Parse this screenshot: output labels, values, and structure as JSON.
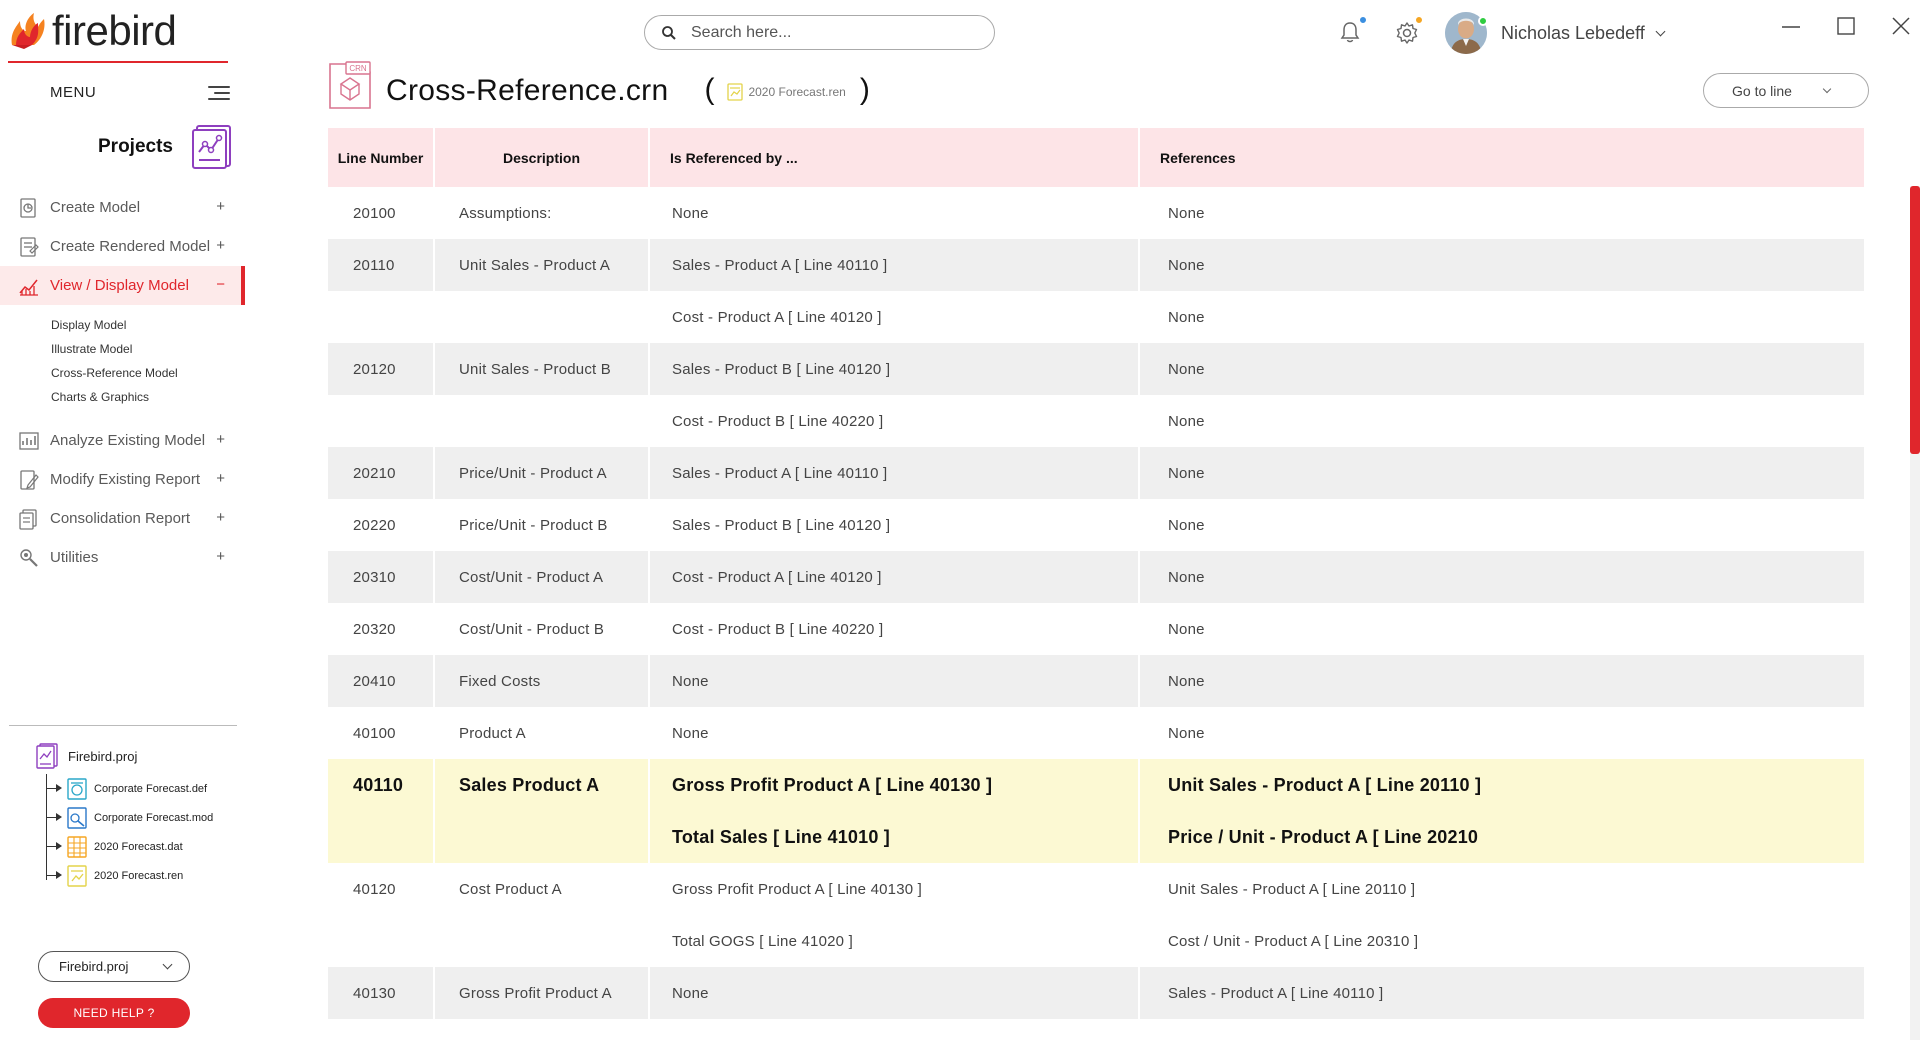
{
  "app": {
    "name": "firebird",
    "accent": "#e0262c"
  },
  "sidebar": {
    "menu_label": "MENU",
    "projects_title": "Projects",
    "nav": [
      {
        "label": "Create Model",
        "sign": "+"
      },
      {
        "label": "Create Rendered Model",
        "sign": "+"
      },
      {
        "label": "View / Display Model",
        "sign": "−",
        "active": true
      },
      {
        "label": "Analyze Existing Model",
        "sign": "+"
      },
      {
        "label": "Modify Existing Report",
        "sign": "+"
      },
      {
        "label": "Consolidation Report",
        "sign": "+"
      },
      {
        "label": "Utilities",
        "sign": "+"
      }
    ],
    "subnav": [
      "Display Model",
      "Illustrate Model",
      "Cross-Reference Model",
      "Charts & Graphics"
    ],
    "tree": {
      "root": "Firebird.proj",
      "children": [
        "Corporate Forecast.def",
        "Corporate Forecast.mod",
        "2020 Forecast.dat",
        "2020 Forecast.ren"
      ]
    },
    "project_select": "Firebird.proj",
    "help_label": "NEED HELP ?"
  },
  "topbar": {
    "search_placeholder": "Search here...",
    "user_name": "Nicholas Lebedeff",
    "notification_dot": "#3b8fe0",
    "settings_dot": "#f5a623"
  },
  "page": {
    "title": "Cross-Reference.crn",
    "paren_open": "(",
    "paren_close": ")",
    "source_file": "2020 Forecast.ren",
    "goto_label": "Go to line"
  },
  "table": {
    "headers": {
      "line": "Line Number",
      "description": "Description",
      "referenced_by": "Is Referenced by ...",
      "references": "References"
    },
    "rows": [
      {
        "line": "20100",
        "description": "Assumptions:",
        "referenced_by": "None",
        "references": "None",
        "style": "plain"
      },
      {
        "line": "20110",
        "description": "Unit Sales - Product A",
        "referenced_by": "Sales - Product A [ Line 40110 ]",
        "references": "None",
        "style": "shade"
      },
      {
        "line": "",
        "description": "",
        "referenced_by": "Cost - Product A [ Line 40120 ]",
        "references": "None",
        "style": "plain"
      },
      {
        "line": "20120",
        "description": "Unit Sales - Product B",
        "referenced_by": "Sales - Product B [ Line 40120 ]",
        "references": "None",
        "style": "shade"
      },
      {
        "line": "",
        "description": "",
        "referenced_by": "Cost - Product B [ Line 40220 ]",
        "references": "None",
        "style": "plain"
      },
      {
        "line": "20210",
        "description": "Price/Unit - Product A",
        "referenced_by": "Sales - Product A [ Line 40110 ]",
        "references": "None",
        "style": "shade"
      },
      {
        "line": "20220",
        "description": "Price/Unit - Product B",
        "referenced_by": "Sales - Product B [ Line 40120 ]",
        "references": "None",
        "style": "plain"
      },
      {
        "line": "20310",
        "description": "Cost/Unit - Product A",
        "referenced_by": "Cost - Product A [ Line 40120 ]",
        "references": "None",
        "style": "shade"
      },
      {
        "line": "20320",
        "description": "Cost/Unit - Product B",
        "referenced_by": "Cost - Product B [ Line 40220 ]",
        "references": "None",
        "style": "plain"
      },
      {
        "line": "20410",
        "description": "Fixed Costs",
        "referenced_by": "None",
        "references": "None",
        "style": "shade"
      },
      {
        "line": "40100",
        "description": "Product A",
        "referenced_by": "None",
        "references": "None",
        "style": "plain"
      },
      {
        "line": "40110",
        "description": "Sales Product A",
        "referenced_by": "Gross Profit Product A [ Line 40130 ]",
        "references": "Unit Sales - Product A [ Line 20110 ]",
        "style": "hl"
      },
      {
        "line": "",
        "description": "",
        "referenced_by": "Total Sales [ Line 41010 ]",
        "references": "Price / Unit - Product A [ Line 20210",
        "style": "hl"
      },
      {
        "line": "40120",
        "description": "Cost Product A",
        "referenced_by": "Gross Profit Product A [ Line 40130 ]",
        "references": "Unit Sales - Product A [ Line 20110 ]",
        "style": "plain"
      },
      {
        "line": "",
        "description": "",
        "referenced_by": "Total GOGS [ Line 41020 ]",
        "references": "Cost / Unit - Product A [ Line 20310 ]",
        "style": "plain"
      },
      {
        "line": "40130",
        "description": "Gross Profit Product A",
        "referenced_by": "None",
        "references": "Sales - Product A [ Line 40110 ]",
        "style": "shade"
      }
    ]
  }
}
